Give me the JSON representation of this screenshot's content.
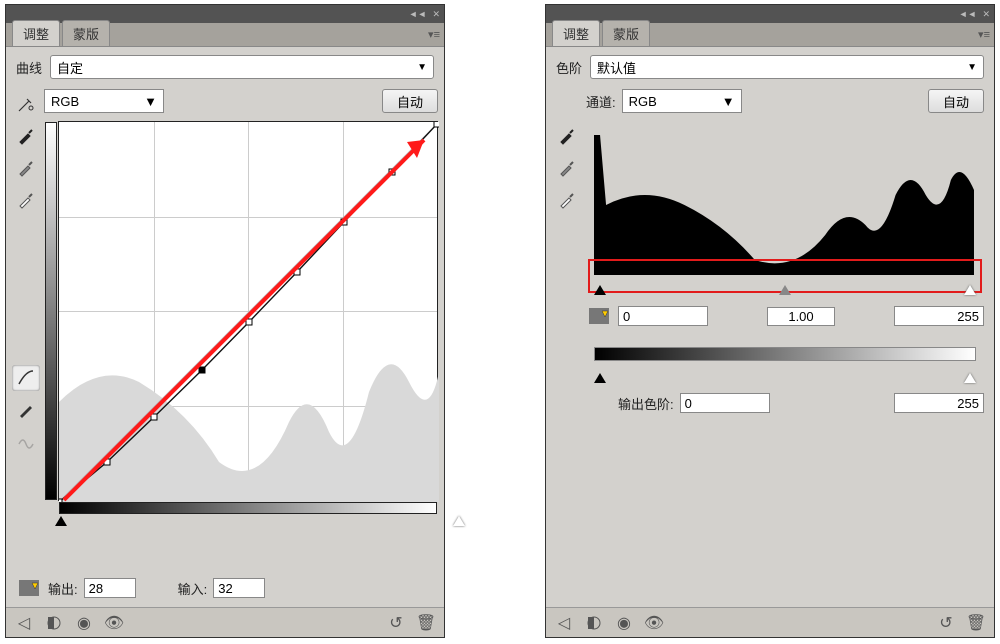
{
  "tabs": {
    "adjust": "调整",
    "masks": "蒙版"
  },
  "curves": {
    "title": "曲线",
    "preset": "自定",
    "channel": "RGB",
    "auto": "自动",
    "output_label": "输出:",
    "input_label": "输入:",
    "output_value": "28",
    "input_value": "32"
  },
  "levels": {
    "title": "色阶",
    "preset": "默认值",
    "channel_label": "通道:",
    "channel": "RGB",
    "auto": "自动",
    "shadow": "0",
    "mid": "1.00",
    "highlight": "255",
    "output_label": "输出色阶:",
    "out_black": "0",
    "out_white": "255"
  }
}
